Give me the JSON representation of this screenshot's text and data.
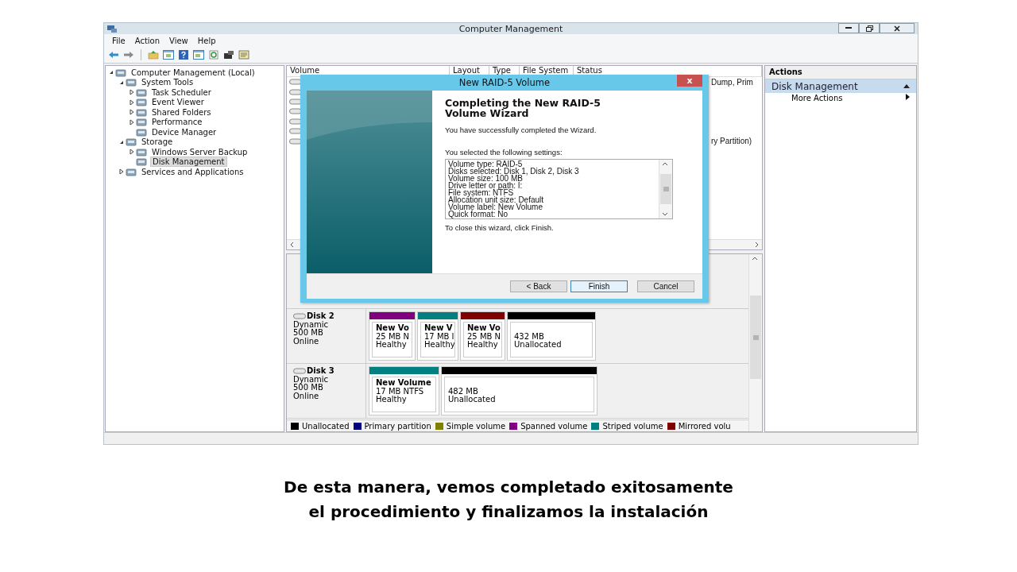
{
  "window": {
    "title": "Computer Management"
  },
  "menu": [
    "File",
    "Action",
    "View",
    "Help"
  ],
  "tree": [
    {
      "label": "Computer Management (Local)",
      "selected": false,
      "expanded": true,
      "children": [
        {
          "label": "System Tools",
          "selected": false,
          "expanded": true,
          "children": [
            {
              "label": "Task Scheduler",
              "selected": false,
              "expanded": false
            },
            {
              "label": "Event Viewer",
              "selected": false,
              "expanded": false
            },
            {
              "label": "Shared Folders",
              "selected": false,
              "expanded": false
            },
            {
              "label": "Performance",
              "selected": false,
              "expanded": false
            },
            {
              "label": "Device Manager",
              "selected": false
            }
          ]
        },
        {
          "label": "Storage",
          "selected": false,
          "expanded": true,
          "children": [
            {
              "label": "Windows Server Backup",
              "selected": false,
              "expanded": false
            },
            {
              "label": "Disk Management",
              "selected": true
            }
          ]
        },
        {
          "label": "Services and Applications",
          "selected": false,
          "expanded": false
        }
      ]
    }
  ],
  "volume_list": {
    "columns": [
      "Volume",
      "Layout",
      "Type",
      "File System",
      "Status"
    ],
    "rows": [
      {
        "status": "Dump, Prim"
      },
      {},
      {},
      {},
      {},
      {},
      {
        "status": "ry Partition)"
      }
    ]
  },
  "disks": [
    {
      "name": "Disk 2",
      "type": "Dynamic",
      "size": "500 MB",
      "status": "Online",
      "partitions": [
        {
          "name": "New Vo",
          "size": "25 MB N",
          "status": "Healthy",
          "color": "#800080"
        },
        {
          "name": "New V",
          "size": "17 MB I",
          "status": "Healthy",
          "color": "#008080"
        },
        {
          "name": "New Vo",
          "size": "25 MB N",
          "status": "Healthy",
          "color": "#800000"
        },
        {
          "size": "432 MB",
          "status": "Unallocated",
          "color": "#000000"
        }
      ]
    },
    {
      "name": "Disk 3",
      "type": "Dynamic",
      "size": "500 MB",
      "status": "Online",
      "partitions": [
        {
          "name": "New Volume",
          "size": "17 MB NTFS",
          "status": "Healthy",
          "color": "#008080"
        },
        {
          "size": "482 MB",
          "status": "Unallocated",
          "color": "#000000"
        }
      ]
    }
  ],
  "legend": [
    {
      "label": "Unallocated",
      "color": "#000000"
    },
    {
      "label": "Primary partition",
      "color": "#000080"
    },
    {
      "label": "Simple volume",
      "color": "#808000"
    },
    {
      "label": "Spanned volume",
      "color": "#800080"
    },
    {
      "label": "Striped volume",
      "color": "#008080"
    },
    {
      "label": "Mirrored volu",
      "color": "#800000"
    }
  ],
  "actions": {
    "title": "Actions",
    "section": {
      "label": "Disk Management",
      "expanded": true
    },
    "items": [
      "More Actions"
    ]
  },
  "dialog": {
    "title": "New RAID-5 Volume",
    "close": "x",
    "heading": "Completing the New RAID-5 Volume Wizard",
    "intro": "You have successfully completed the Wizard.",
    "settings_label": "You selected the following settings:",
    "settings": [
      "Volume type: RAID-5",
      "Disks selected: Disk 1, Disk 2, Disk 3",
      "Volume size: 100 MB",
      "Drive letter or path: I:",
      "File system: NTFS",
      "Allocation unit size: Default",
      "Volume label: New Volume",
      "Quick format: No"
    ],
    "footer": "To close this wizard, click Finish.",
    "buttons": [
      {
        "label": "< Back",
        "default": false
      },
      {
        "label": "Finish",
        "default": true
      },
      {
        "label": "Cancel",
        "default": false
      }
    ]
  },
  "caption": "De esta manera, vemos completado exitosamente\nel procedimiento y finalizamos la instalación"
}
